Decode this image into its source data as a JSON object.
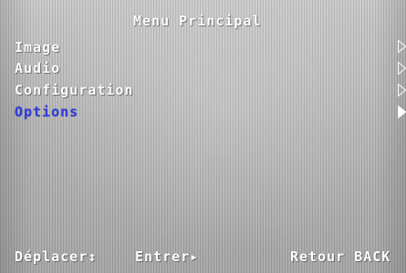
{
  "title": "Menu Principal",
  "menu": {
    "items": [
      {
        "label": "Image",
        "selected": false
      },
      {
        "label": "Audio",
        "selected": false
      },
      {
        "label": "Configuration",
        "selected": false
      },
      {
        "label": "Options",
        "selected": true
      }
    ]
  },
  "footer": {
    "move": "Déplacer↕",
    "enter": "Entrer▸",
    "back": "Retour BACK"
  },
  "colors": {
    "text": "#ffffff",
    "selected": "#2f3bd9",
    "background": "#b8b8b8"
  },
  "icons": {
    "submenu": "triangle-right-icon"
  }
}
